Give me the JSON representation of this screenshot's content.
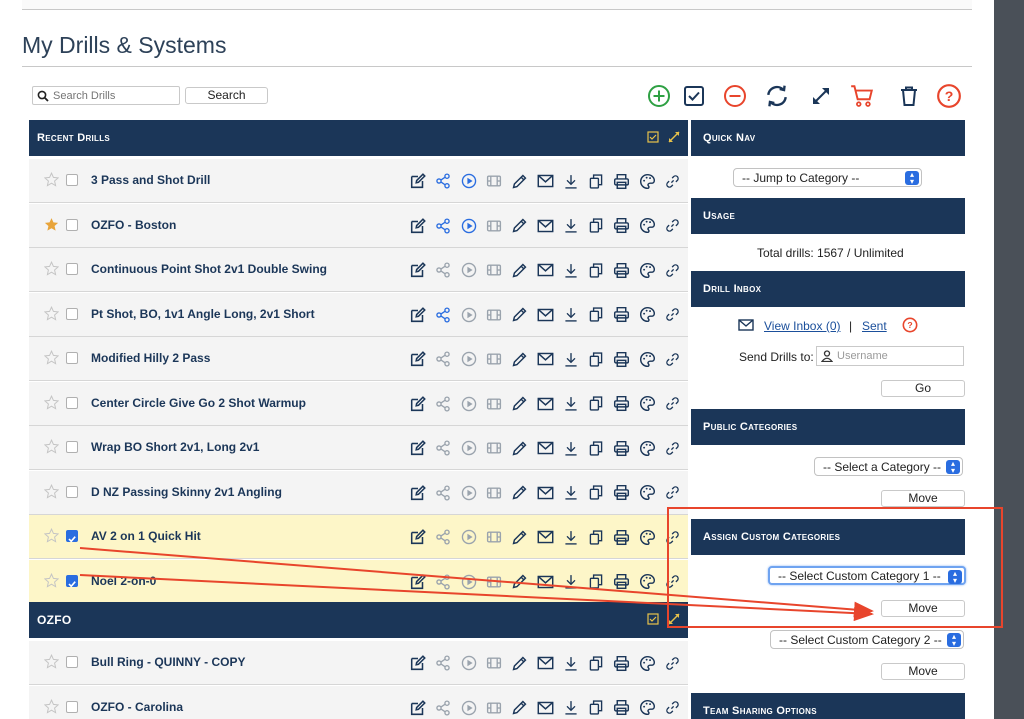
{
  "page": {
    "title": "My Drills & Systems"
  },
  "search": {
    "placeholder": "Search Drills",
    "button_label": "Search"
  },
  "toolbar": {
    "icons": [
      "plus-circle-icon",
      "check-square-icon",
      "minus-circle-icon",
      "sync-icon",
      "expand-icon",
      "cart-icon",
      "trash-icon",
      "help-icon"
    ]
  },
  "colors": {
    "navy": "#1b3658",
    "green": "#2ea043",
    "red": "#e8452c",
    "blue": "#2a6de0",
    "gold": "#e8a43a",
    "highlight": "#fdf6c8"
  },
  "recent": {
    "title": "Recent Drills",
    "drills": [
      {
        "name": "3 Pass and Shot Drill",
        "starred": false,
        "checked": false,
        "shared": true,
        "playable": true
      },
      {
        "name": "OZFO - Boston",
        "starred": true,
        "checked": false,
        "shared": true,
        "playable": true
      },
      {
        "name": "Continuous Point Shot 2v1 Double Swing",
        "starred": false,
        "checked": false,
        "shared": false,
        "playable": false
      },
      {
        "name": "Pt Shot, BO, 1v1 Angle Long, 2v1 Short",
        "starred": false,
        "checked": false,
        "shared": true,
        "playable": false
      },
      {
        "name": "Modified Hilly 2 Pass",
        "starred": false,
        "checked": false,
        "shared": false,
        "playable": false
      },
      {
        "name": "Center Circle Give Go 2 Shot Warmup",
        "starred": false,
        "checked": false,
        "shared": false,
        "playable": false
      },
      {
        "name": "Wrap BO Short 2v1, Long 2v1",
        "starred": false,
        "checked": false,
        "shared": false,
        "playable": false
      },
      {
        "name": "D NZ Passing Skinny 2v1 Angling",
        "starred": false,
        "checked": false,
        "shared": false,
        "playable": false
      },
      {
        "name": "AV 2 on 1 Quick Hit",
        "starred": false,
        "checked": true,
        "shared": false,
        "playable": false
      },
      {
        "name": "Noel 2-on-0",
        "starred": false,
        "checked": true,
        "shared": false,
        "playable": false
      }
    ]
  },
  "ozfo": {
    "title": "OZFO",
    "drills": [
      {
        "name": "Bull Ring - QUINNY - COPY",
        "starred": false,
        "checked": false,
        "shared": false,
        "playable": false
      },
      {
        "name": "OZFO - Carolina",
        "starred": false,
        "checked": false,
        "shared": false,
        "playable": false
      }
    ]
  },
  "sidebar": {
    "quick_nav": {
      "title": "Quick Nav",
      "select": "-- Jump to Category --"
    },
    "usage": {
      "title": "Usage",
      "text": "Total drills: 1567 / Unlimited"
    },
    "inbox": {
      "title": "Drill Inbox",
      "view_link": "View Inbox (0)",
      "separator": "|",
      "sent_link": "Sent",
      "send_label": "Send Drills to:",
      "username_placeholder": "Username",
      "go_label": "Go"
    },
    "public": {
      "title": "Public Categories",
      "select": "-- Select a Category --",
      "move_label": "Move"
    },
    "custom": {
      "title": "Assign Custom Categories",
      "select1": "-- Select Custom Category 1 --",
      "move1": "Move",
      "select2": "-- Select Custom Category 2 --",
      "move2": "Move"
    },
    "team": {
      "title": "Team Sharing Options"
    }
  }
}
